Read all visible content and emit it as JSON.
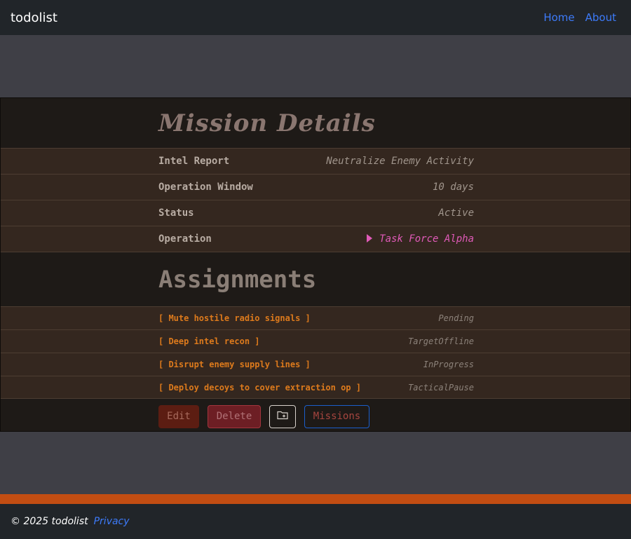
{
  "nav": {
    "brand": "todolist",
    "links": [
      {
        "label": "Home"
      },
      {
        "label": "About"
      }
    ]
  },
  "mission": {
    "title": "Mission Details",
    "details": [
      {
        "label": "Intel Report",
        "value": "Neutralize Enemy Activity"
      },
      {
        "label": "Operation Window",
        "value": "10 days"
      },
      {
        "label": "Status",
        "value": "Active"
      },
      {
        "label": "Operation",
        "value": "Task Force Alpha"
      }
    ]
  },
  "assignments": {
    "title": "Assignments",
    "items": [
      {
        "name": "[ Mute hostile radio signals ]",
        "status": "Pending"
      },
      {
        "name": "[ Deep intel recon ]",
        "status": "TargetOffline"
      },
      {
        "name": "[ Disrupt enemy supply lines ]",
        "status": "InProgress"
      },
      {
        "name": "[ Deploy decoys to cover extraction op ]",
        "status": "TacticalPause"
      }
    ]
  },
  "actions": {
    "edit": "Edit",
    "delete": "Delete",
    "folder_icon": "folder-plus-icon",
    "missions": "Missions"
  },
  "footer": {
    "copyright": "© 2025 todolist",
    "privacy": "Privacy"
  },
  "colors": {
    "navbar_bg": "#212529",
    "page_bg": "#3f3f46",
    "card_bg": "#1e1a17",
    "row_bg": "#34271f",
    "accent_orange": "#dd7a1c",
    "accent_pink": "#e05ab8",
    "link_blue": "#3d7bfa",
    "footer_stripe": "#c24d12"
  }
}
